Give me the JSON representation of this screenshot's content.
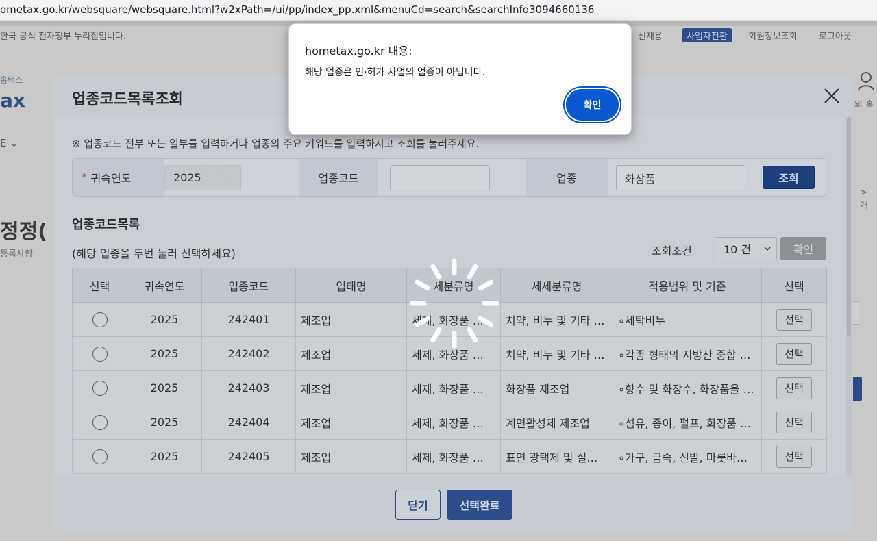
{
  "browser": {
    "url": "ometax.go.kr/websquare/websquare.html?w2xPath=/ui/pp/index_pp.xml&menuCd=search&searchInfo3094660136"
  },
  "background": {
    "notice": "한국 공식 전자정부 누리집입니다.",
    "menu": [
      "신재용",
      "사업자전환",
      "회원정보조회",
      "로그아웃"
    ],
    "logo_small": "홈택스",
    "logo": "ax",
    "nav_item": "E",
    "page_title": "정정(",
    "page_subtitle": "등록사항",
    "right_text": "의 홈",
    "right_arrow": "> 개"
  },
  "modal": {
    "title": "업종코드목록조회",
    "instruction": "※ 업종코드 전부 또는 일부를 입력하거나 업종의 주요 키워드를 입력하시고 조회를 눌러주세요.",
    "search": {
      "year_label": "귀속연도",
      "year_value": "2025",
      "code_label": "업종코드",
      "code_value": "",
      "industry_label": "업종",
      "industry_value": "화장품",
      "search_button": "조회"
    },
    "list_title": "업종코드목록",
    "list_hint": "(해당 업종을 두번 눌러 선택하세요)",
    "condition_label": "조회조건",
    "condition_value": "10 건",
    "condition_confirm": "확인",
    "table": {
      "headers": [
        "선택",
        "귀속연도",
        "업종코드",
        "업태명",
        "세분류명",
        "세세분류명",
        "적용범위 및 기준",
        "선택"
      ],
      "rows": [
        {
          "year": "2025",
          "code": "242401",
          "type": "제조업",
          "sub": "세제, 화장품 …",
          "subsub": "치약, 비누 및 기타 …",
          "scope": "∘세탁비누",
          "btn": "선택"
        },
        {
          "year": "2025",
          "code": "242402",
          "type": "제조업",
          "sub": "세제, 화장품 …",
          "subsub": "치약, 비누 및 기타 …",
          "scope": "∘각종 형태의 지방산 중합 …",
          "btn": "선택"
        },
        {
          "year": "2025",
          "code": "242403",
          "type": "제조업",
          "sub": "세제, 화장품 …",
          "subsub": "화장품 제조업",
          "scope": "∘향수 및 화장수, 화장품을 …",
          "btn": "선택"
        },
        {
          "year": "2025",
          "code": "242404",
          "type": "제조업",
          "sub": "세제, 화장품 …",
          "subsub": "계면활성제 제조업",
          "scope": "∘섬유, 종이, 펄프, 화장품 …",
          "btn": "선택"
        },
        {
          "year": "2025",
          "code": "242405",
          "type": "제조업",
          "sub": "세제, 화장품 …",
          "subsub": "표면 광택제 및 실…",
          "scope": "∘가구, 금속, 신발, 마룻바…",
          "btn": "선택"
        }
      ]
    },
    "footer": {
      "close_button": "닫기",
      "done_button": "선택완료"
    }
  },
  "alert": {
    "title": "hometax.go.kr 내용:",
    "message": "해당 업종은 인·허가 사업의 업종이 아닙니다.",
    "ok_button": "확인"
  },
  "colors": {
    "alert_button": "#0b57d0",
    "primary_navy": "#1f3f7c"
  }
}
